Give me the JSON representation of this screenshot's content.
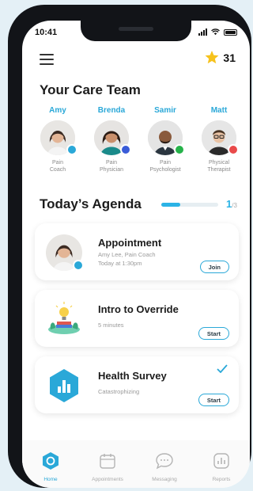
{
  "status": {
    "time": "10:41"
  },
  "header": {
    "stars": "31"
  },
  "care_team": {
    "title": "Your Care Team",
    "members": [
      {
        "name": "Amy",
        "role_line1": "Pain",
        "role_line2": "Coach",
        "badge_color": "#2aa8d8"
      },
      {
        "name": "Brenda",
        "role_line1": "Pain",
        "role_line2": "Physician",
        "badge_color": "#3a5cd8"
      },
      {
        "name": "Samir",
        "role_line1": "Pain",
        "role_line2": "Psychologist",
        "badge_color": "#26b24a"
      },
      {
        "name": "Matt",
        "role_line1": "Physical",
        "role_line2": "Therapist",
        "badge_color": "#e94a4a"
      }
    ]
  },
  "agenda": {
    "title": "Today’s Agenda",
    "progress_done": "1",
    "progress_total": "/3",
    "progress_fraction": 0.33,
    "cards": [
      {
        "title": "Appointment",
        "line1": "Amy Lee, Pain Coach",
        "line2": "Today at 1:30pm",
        "button": "Join"
      },
      {
        "title": "Intro to Override",
        "line1": "5 minutes",
        "button": "Start"
      },
      {
        "title": "Health Survey",
        "line1": "Catastrophizing",
        "button": "Start",
        "completed": true
      }
    ]
  },
  "tabs": [
    {
      "label": "Home",
      "icon": "home-icon",
      "active": true
    },
    {
      "label": "Appointments",
      "icon": "calendar-icon"
    },
    {
      "label": "Messaging",
      "icon": "chat-icon"
    },
    {
      "label": "Reports",
      "icon": "chart-icon"
    }
  ],
  "colors": {
    "accent": "#2aa8d8",
    "star": "#f6c21c",
    "check": "#2aa8d8"
  }
}
